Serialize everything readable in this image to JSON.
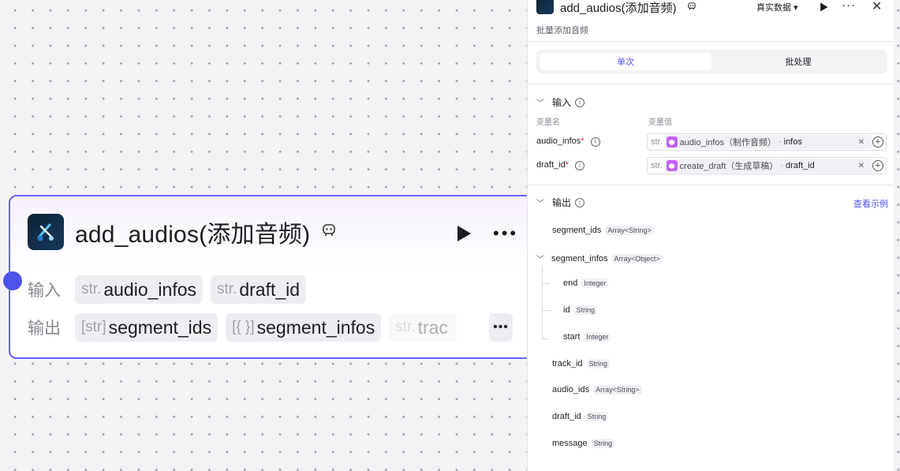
{
  "node": {
    "title": "add_audios(添加音频)",
    "input_label": "输入",
    "output_label": "输出",
    "inputs": [
      {
        "type": "str.",
        "name": "audio_infos"
      },
      {
        "type": "str.",
        "name": "draft_id"
      }
    ],
    "outputs": [
      {
        "type": "[str]",
        "name": "segment_ids"
      },
      {
        "type": "[{ }]",
        "name": "segment_infos"
      },
      {
        "type": "str.",
        "name": "trac"
      }
    ]
  },
  "panel": {
    "title": "add_audios(添加音频)",
    "data_mode": "真实数据 ▾",
    "description": "批量添加音频",
    "tabs": [
      "单次",
      "批处理"
    ],
    "input_section": "输入",
    "col_name": "变量名",
    "col_value": "变量值",
    "variables": [
      {
        "name": "audio_infos",
        "req": "*",
        "type": "str.",
        "ref_name": "audio_infos（制作音频）",
        "ref_dot": "·",
        "ref_field": "infos"
      },
      {
        "name": "draft_id",
        "req": "*",
        "type": "str.",
        "ref_name": "create_draft（生成草稿）",
        "ref_dot": "·",
        "ref_field": "draft_id"
      }
    ],
    "output_section": "输出",
    "view_example": "查看示例",
    "outputs": [
      {
        "name": "segment_ids",
        "type": "Array<String>"
      },
      {
        "name": "segment_infos",
        "type": "Array<Object>"
      },
      {
        "name": "end",
        "type": "Integer"
      },
      {
        "name": "id",
        "type": "String"
      },
      {
        "name": "start",
        "type": "Integer"
      },
      {
        "name": "track_id",
        "type": "String"
      },
      {
        "name": "audio_ids",
        "type": "Array<String>"
      },
      {
        "name": "draft_id",
        "type": "String"
      },
      {
        "name": "message",
        "type": "String"
      }
    ]
  },
  "colors": {
    "accent": "#4d53e8",
    "node_border": "#6c63ff",
    "ref_icon": "#c560f2",
    "required": "#e8323c"
  }
}
